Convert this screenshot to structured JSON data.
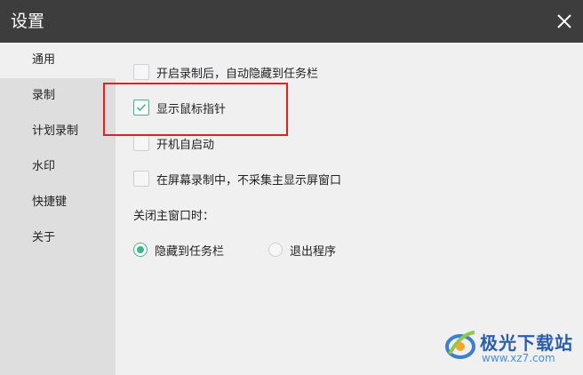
{
  "window": {
    "title": "设置"
  },
  "sidebar": {
    "items": [
      {
        "label": "通用",
        "active": true
      },
      {
        "label": "录制",
        "active": false
      },
      {
        "label": "计划录制",
        "active": false
      },
      {
        "label": "水印",
        "active": false
      },
      {
        "label": "快捷键",
        "active": false
      },
      {
        "label": "关于",
        "active": false
      }
    ]
  },
  "general": {
    "options": [
      {
        "label": "开启录制后，自动隐藏到任务栏",
        "checked": false
      },
      {
        "label": "显示鼠标指针",
        "checked": true
      },
      {
        "label": "开机自启动",
        "checked": false
      },
      {
        "label": "在屏幕录制中，不采集主显示屏窗口",
        "checked": false
      }
    ],
    "close_label": "关闭主窗口时：",
    "close_options": [
      {
        "label": "隐藏到任务栏",
        "selected": true
      },
      {
        "label": "退出程序",
        "selected": false
      }
    ]
  },
  "watermark": {
    "brand": "极光下载站",
    "url": "www.xz7.com"
  },
  "colors": {
    "accent": "#3cb48c",
    "titlebar": "#3d3d3d",
    "highlight": "#e61e1e"
  }
}
